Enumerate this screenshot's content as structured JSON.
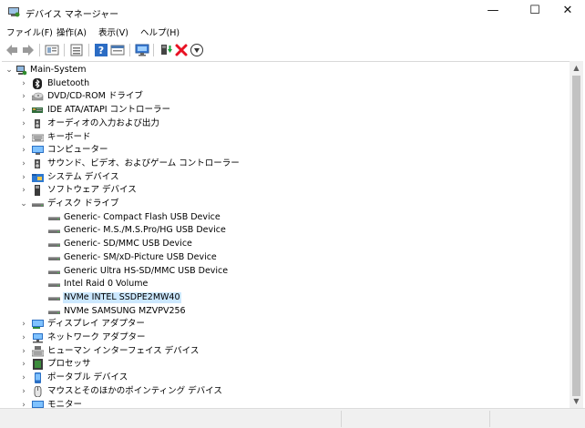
{
  "window": {
    "title": "デバイス マネージャー",
    "min_glyph": "—",
    "max_glyph": "☐",
    "close_glyph": "✕"
  },
  "menu": [
    "ファイル(F)",
    "操作(A)",
    "表示(V)",
    "ヘルプ(H)"
  ],
  "tree": {
    "root": "Main-System",
    "categories": [
      "Bluetooth",
      "DVD/CD-ROM ドライブ",
      "IDE ATA/ATAPI コントローラー",
      "オーディオの入力および出力",
      "キーボード",
      "コンピューター",
      "サウンド、ビデオ、およびゲーム コントローラー",
      "システム デバイス",
      "ソフトウェア デバイス",
      "ディスク ドライブ"
    ],
    "disk_devices": [
      "Generic- Compact Flash USB Device",
      "Generic- M.S./M.S.Pro/HG USB Device",
      "Generic- SD/MMC USB Device",
      "Generic- SM/xD-Picture USB Device",
      "Generic Ultra HS-SD/MMC USB Device",
      "Intel Raid 0 Volume",
      "NVMe INTEL SSDPE2MW40",
      "NVMe SAMSUNG MZVPV256"
    ],
    "more_categories": [
      "ディスプレイ アダプター",
      "ネットワーク アダプター",
      "ヒューマン インターフェイス デバイス",
      "プロセッサ",
      "ポータブル デバイス",
      "マウスとそのほかのポインティング デバイス",
      "モニター"
    ]
  },
  "colors": {
    "selection": "#cce8ff",
    "delete_red": "#e81123",
    "accent_blue": "#2b6cc4"
  }
}
